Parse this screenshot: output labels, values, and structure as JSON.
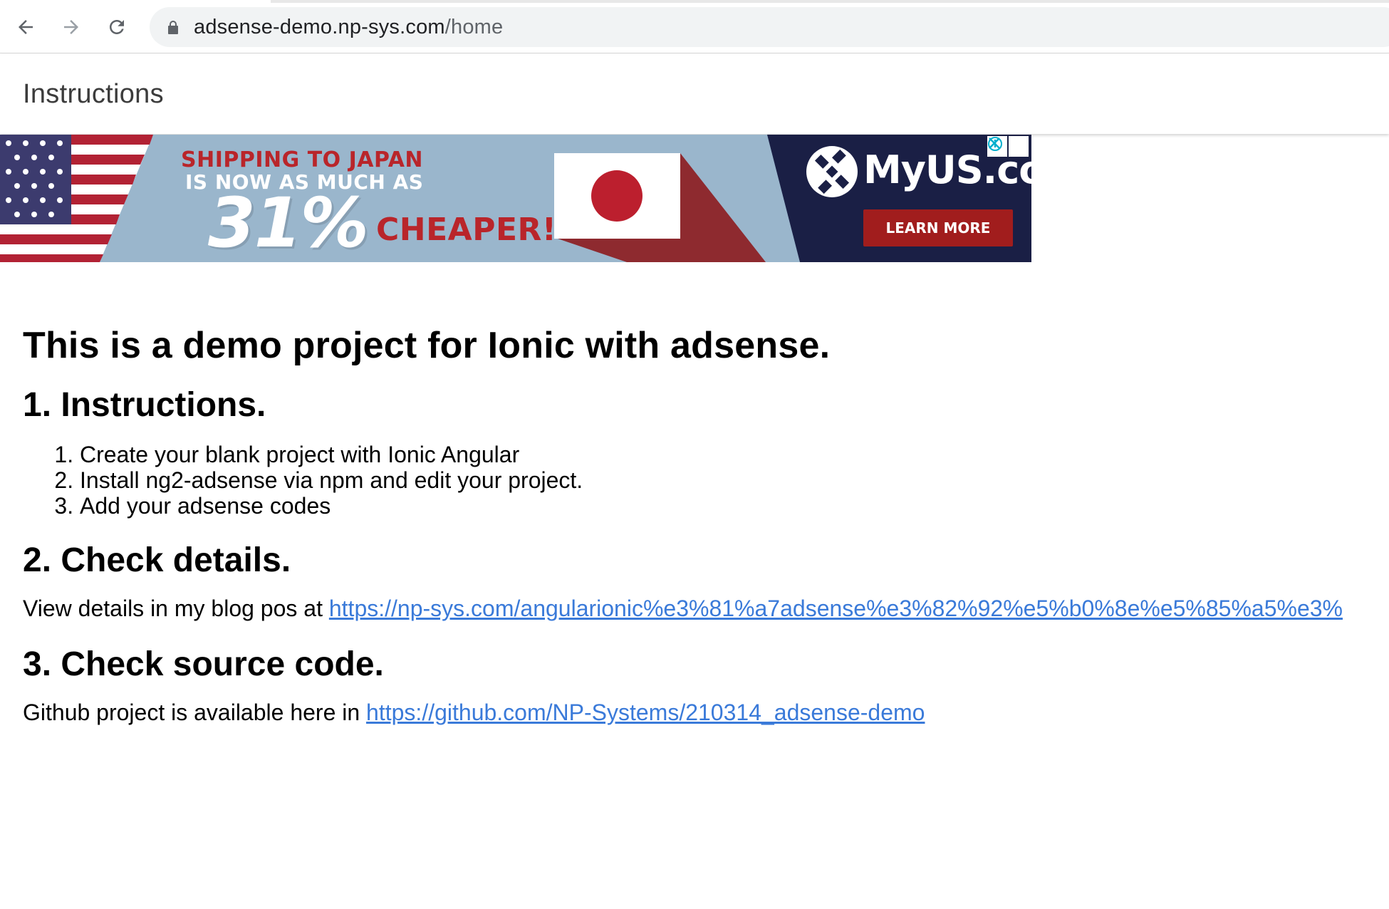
{
  "browser": {
    "url_domain": "adsense-demo.np-sys.com",
    "url_path": "/home",
    "back_icon": "arrow-left-icon",
    "forward_icon": "arrow-right-icon",
    "reload_icon": "reload-icon",
    "lock_icon": "lock-icon"
  },
  "header": {
    "title": "Instructions"
  },
  "ad": {
    "line1": "SHIPPING TO JAPAN",
    "line2": "IS NOW AS MUCH AS",
    "percent": "31%",
    "cheaper": "CHEAPER!",
    "brand": "MyUS.com",
    "cta": "LEARN MORE",
    "colors": {
      "background": "#9ab6cc",
      "navy": "#1a1f45",
      "red": "#b9252a"
    }
  },
  "main": {
    "heading": "This is a demo project for Ionic with adsense.",
    "section1": {
      "title": "1. Instructions.",
      "steps": [
        "Create your blank project with Ionic Angular",
        "Install ng2-adsense via npm and edit your project.",
        "Add your adsense codes"
      ]
    },
    "section2": {
      "title": "2. Check details.",
      "text": "View details in my blog pos at ",
      "link": "https://np-sys.com/angularionic%e3%81%a7adsense%e3%82%92%e5%b0%8e%e5%85%a5%e3%"
    },
    "section3": {
      "title": "3. Check source code.",
      "text": "Github project is available here in ",
      "link": "https://github.com/NP-Systems/210314_adsense-demo"
    }
  }
}
